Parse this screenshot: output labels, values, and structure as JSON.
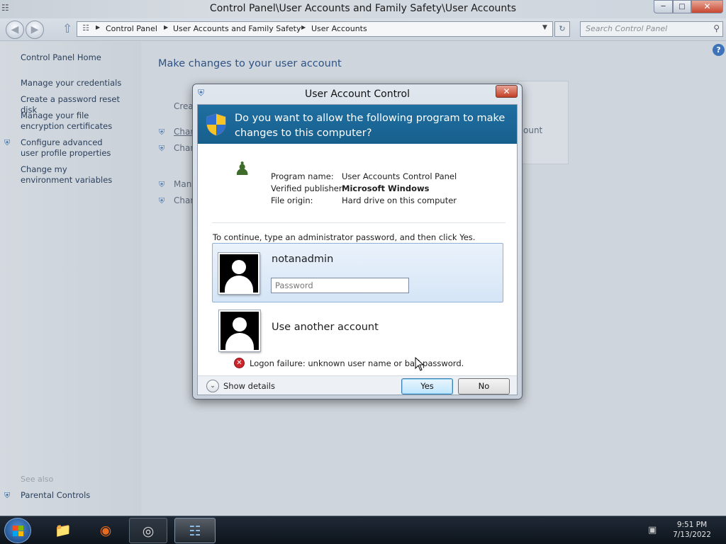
{
  "window": {
    "title": "Control Panel\\User Accounts and Family Safety\\User Accounts",
    "address_crumbs": [
      "Control Panel",
      "User Accounts and Family Safety",
      "User Accounts"
    ],
    "search_placeholder": "Search Control Panel"
  },
  "sidebar": {
    "home": "Control Panel Home",
    "links": [
      "Manage your credentials",
      "Create a password reset disk",
      "Manage your file encryption certificates",
      "Configure advanced user profile properties",
      "Change my environment variables"
    ],
    "see_also_title": "See also",
    "see_also_links": [
      "Parental Controls"
    ]
  },
  "main": {
    "title": "Make changes to your user account",
    "partial_links": [
      "Crea",
      "Chan",
      "Chan",
      "Man",
      "Chan"
    ],
    "partial_panel_text": "ount"
  },
  "uac": {
    "title": "User Account Control",
    "question": "Do you want to allow the following program to make changes to this computer?",
    "program_name_label": "Program name:",
    "program_name": "User Accounts Control Panel",
    "publisher_label": "Verified publisher:",
    "publisher": "Microsoft Windows",
    "origin_label": "File origin:",
    "origin": "Hard drive on this computer",
    "instruction": "To continue, type an administrator password, and then click Yes.",
    "account_name": "notanadmin",
    "password_placeholder": "Password",
    "other_account": "Use another account",
    "error": "Logon failure: unknown user name or bad password.",
    "show_details": "Show details",
    "yes": "Yes",
    "no": "No"
  },
  "taskbar": {
    "clock_time": "9:51 PM",
    "clock_date": "7/13/2022"
  }
}
